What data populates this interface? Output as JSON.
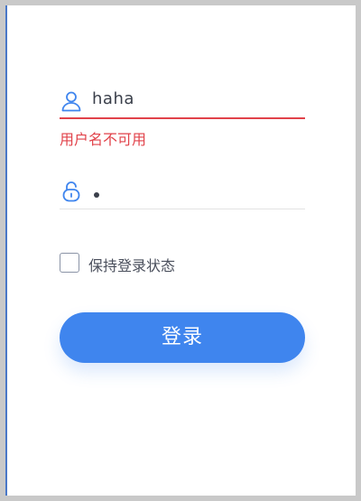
{
  "form": {
    "username": {
      "value": "haha",
      "icon": "user-icon",
      "error": "用户名不可用"
    },
    "password": {
      "masked_value": "•",
      "icon": "lock-icon"
    },
    "remember": {
      "label": "保持登录状态",
      "checked": false
    },
    "login_button": {
      "label": "登录"
    }
  },
  "colors": {
    "accent": "#3f85ee",
    "error": "#e1424a",
    "icon": "#3f85ee"
  }
}
